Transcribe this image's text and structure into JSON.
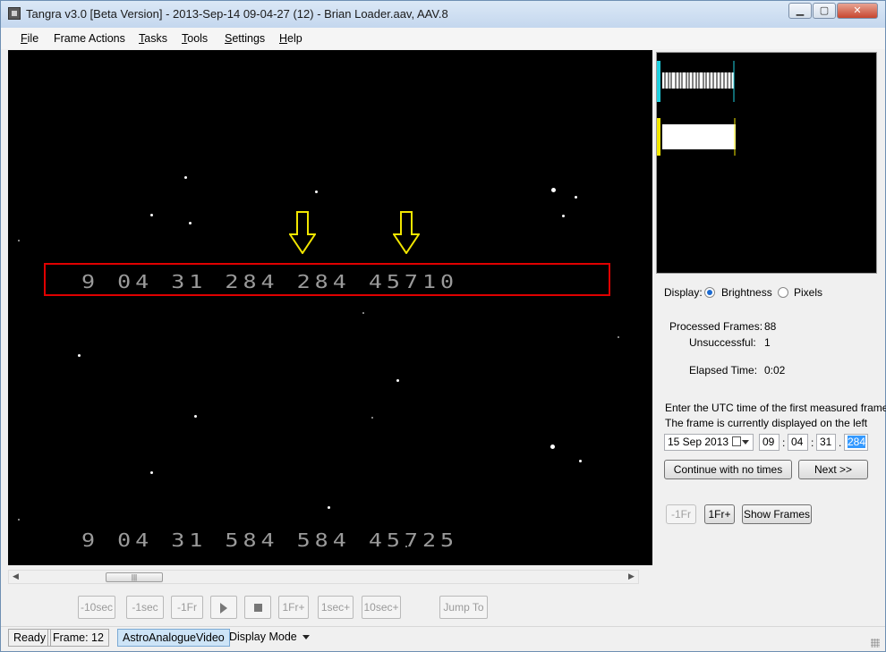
{
  "window": {
    "title": "Tangra v3.0 [Beta Version] - 2013-Sep-14 09-04-27 (12) - Brian Loader.aav, AAV.8",
    "min_glyph": "▁",
    "max_glyph": "▢",
    "close_glyph": "✕"
  },
  "menu": {
    "file": {
      "pre": "",
      "key": "F",
      "post": "ile"
    },
    "frame_actions": {
      "label": "Frame Actions"
    },
    "tasks": {
      "pre": "",
      "key": "T",
      "post": "asks"
    },
    "tools": {
      "pre": "",
      "key": "T",
      "post": "ools"
    },
    "settings": {
      "pre": "",
      "key": "S",
      "post": "ettings"
    },
    "help": {
      "pre": "",
      "key": "H",
      "post": "elp"
    }
  },
  "video": {
    "osd_top": "9 04 31  284  284  45710",
    "osd_bottom": "9 04 31  584  584  45725",
    "arrow_color": "#f2e600",
    "box_color": "#e00000"
  },
  "scrollbar": {
    "left": "◀",
    "right": "▶",
    "thumb": "|||"
  },
  "navigation": {
    "minus_10sec": "-10sec",
    "minus_1sec": "-1sec",
    "minus_1fr": "-1Fr",
    "plus_1fr": "1Fr+",
    "plus_1sec": "1sec+",
    "plus_10sec": "10sec+",
    "jump_to": "Jump To"
  },
  "status": {
    "ready": "Ready",
    "frame": "Frame: 12",
    "source": "AstroAnalogueVideo",
    "display_mode": "Display Mode"
  },
  "panel": {
    "display_label": "Display:",
    "brightness": "Brightness",
    "pixels": "Pixels",
    "processed_label": "Processed Frames:",
    "processed_value": "88",
    "unsuccessful_label": "Unsuccessful:",
    "unsuccessful_value": "1",
    "elapsed_label": "Elapsed Time:",
    "elapsed_value": "0:02",
    "utc_prompt": "Enter the UTC time of the first measured frame:",
    "frame_hint": "The frame is currently displayed on the left",
    "date": "15 Sep 2013",
    "hours": "09",
    "minutes": "04",
    "seconds": "31",
    "ms": "284",
    "sep_colon": ":",
    "sep_dot": ".",
    "continue_btn": "Continue with no times",
    "next_btn": "Next >>",
    "minus_1fr": "-1Fr",
    "plus_1fr": "1Fr+",
    "show_frames": "Show Frames"
  }
}
